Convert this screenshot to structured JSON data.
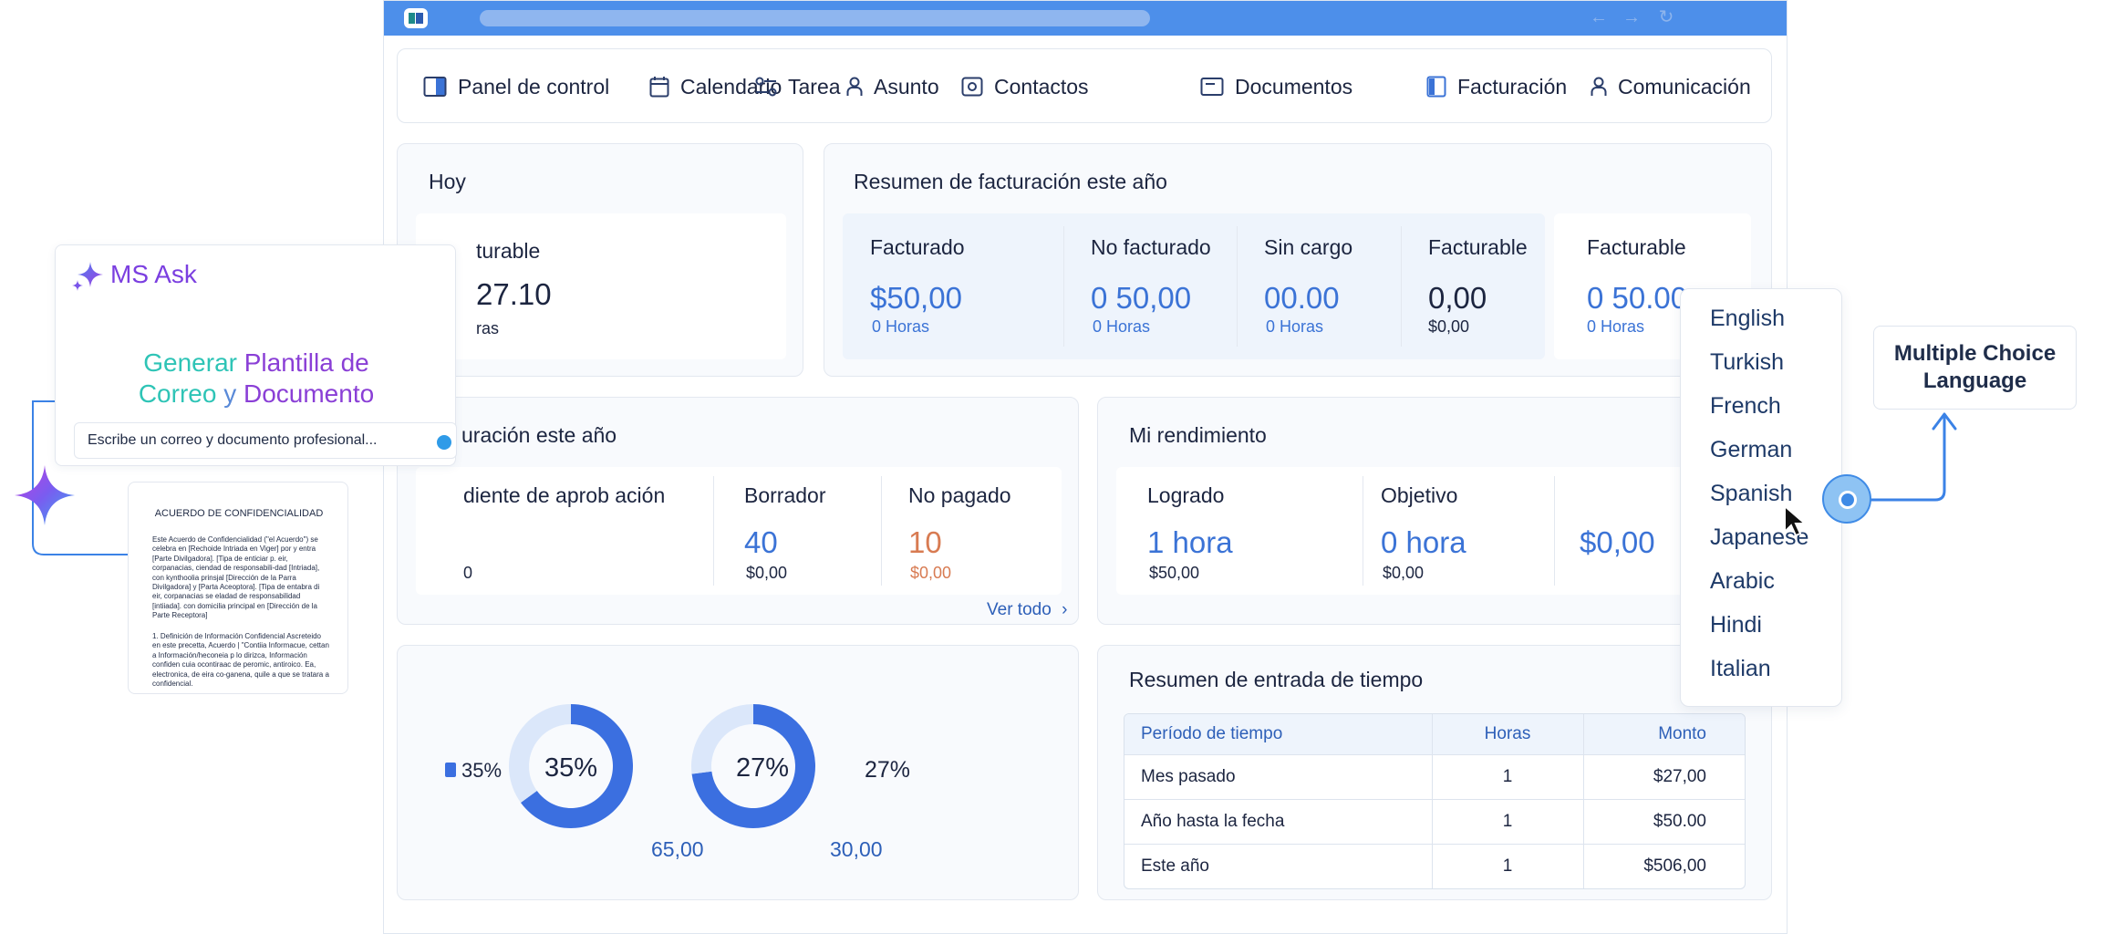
{
  "nav": {
    "items": [
      {
        "label": "Panel de control",
        "icon": "dashboard-icon"
      },
      {
        "label": "Calendario",
        "icon": "calendar-icon"
      },
      {
        "label": "Tarea",
        "icon": "tasks-icon"
      },
      {
        "label": "Asunto",
        "icon": "person-icon"
      },
      {
        "label": "Contactos",
        "icon": "contacts-icon"
      },
      {
        "label": "Documentos",
        "icon": "documents-icon"
      },
      {
        "label": "Facturación",
        "icon": "billing-icon"
      },
      {
        "label": "Comunicación",
        "icon": "person-icon"
      }
    ]
  },
  "today": {
    "title": "Hoy",
    "label": "turable",
    "value": "27.10",
    "sub": "ras"
  },
  "billing_summary": {
    "title": "Resumen de facturación este año",
    "items": [
      {
        "label": "Facturado",
        "value": "$50,00",
        "sub": "0 Horas"
      },
      {
        "label": "No facturado",
        "value": "0 50,00",
        "sub": "0 Horas"
      },
      {
        "label": "Sin cargo",
        "value": "00.00",
        "sub": "0 Horas"
      },
      {
        "label": "Facturable",
        "value": "0,00",
        "sub": "$0,00"
      },
      {
        "label": "Facturable",
        "value": "0 50.00",
        "sub": "0 Horas"
      }
    ]
  },
  "invoices": {
    "title": "uración este año",
    "items": [
      {
        "label": "diente de aprob ación",
        "value": "",
        "sub": "0"
      },
      {
        "label": "Borrador",
        "value": "40",
        "sub": "$0,00"
      },
      {
        "label": "No pagado",
        "value": "10",
        "sub": "$0,00"
      }
    ],
    "view_all": "Ver todo",
    "view_all_arrow": "›"
  },
  "performance": {
    "title": "Mi rendimiento",
    "items": [
      {
        "label": "Logrado",
        "value": "1 hora",
        "sub": "$50,00"
      },
      {
        "label": "Objetivo",
        "value": "0 hora",
        "sub": "$0,00"
      },
      {
        "label": "",
        "value": "$0,00",
        "sub": ""
      }
    ]
  },
  "donuts": {
    "legend_left": "35%",
    "left": {
      "center": "35%",
      "bottom_label": "65,00"
    },
    "right": {
      "center": "27%",
      "side_label": "27%",
      "bottom_label": "30,00"
    }
  },
  "chart_data": {
    "type": "pie",
    "charts": [
      {
        "center_label": "35%",
        "value_label": "65,00",
        "highlighted_percent": 65,
        "remaining_percent": 35
      },
      {
        "center_label": "27%",
        "value_label": "30,00",
        "highlighted_percent": 73,
        "remaining_percent": 27
      }
    ],
    "colors": {
      "primary": "#3b6fe0",
      "secondary": "#dbe7fa"
    }
  },
  "time_entry": {
    "title": "Resumen de entrada de tiempo",
    "headers": [
      "Período de tiempo",
      "Horas",
      "Monto"
    ],
    "rows": [
      [
        "Mes pasado",
        "1",
        "$27,00"
      ],
      [
        "Año hasta la fecha",
        "1",
        "$50.00"
      ],
      [
        "Este año",
        "1",
        "$506,00"
      ]
    ]
  },
  "language_menu": {
    "options": [
      "English",
      "Turkish",
      "French",
      "German",
      "Spanish",
      "Japanese",
      "Arabic",
      "Hindi",
      "Italian"
    ],
    "hovered": "Spanish"
  },
  "callout": {
    "line1": "Multiple Choice",
    "line2": "Language"
  },
  "ms_ask": {
    "title": "MS Ask",
    "heading_w1": "Generar",
    "heading_w2": "Plantilla de",
    "heading_w3": "Correo",
    "heading_w4": "y",
    "heading_w5": "Documento",
    "input_value": "Escribe un correo y documento profesional..."
  },
  "nda": {
    "title": "ACUERDO DE CONFIDENCIALIDAD",
    "para1": "Este Acuerdo de Confidencialidad (\"el Acuerdo\") se celebra en [Rechoide Intriada en Viger] por y entra [Parte Divilgadora]. [Tipa de enticiar p. eir, corpanacias, ciendad de responsabili-dad [Intriada], con kynthoolia prinsjal [Dirección de la Parra Divilgadora] y [Parta Aceoptora]. [Tipa de entabra di eir, corpanacias se eladad de responsabilidad [intiiada]. con domicilia principal en [Dirección de la Parte Receptora]",
    "para2": "1. Definición de Información Confidencial Ascreteido en este precetta, Acuerdo | \"Contiia Informacue, cettan a Información/heconeia p lo dirizca, Información confiden cuia ocontiraac de peromic, antiroico. Ea, electronica, de eira co-ganena, quile a que se tratara a confidencial."
  },
  "colors": {
    "accent": "#3b73d6",
    "browser_bar": "#4d8fea",
    "orange_value": "#d87b52",
    "ms_ask_purple": "#7b3fe0",
    "ms_ask_teal": "#2ec4b6"
  }
}
